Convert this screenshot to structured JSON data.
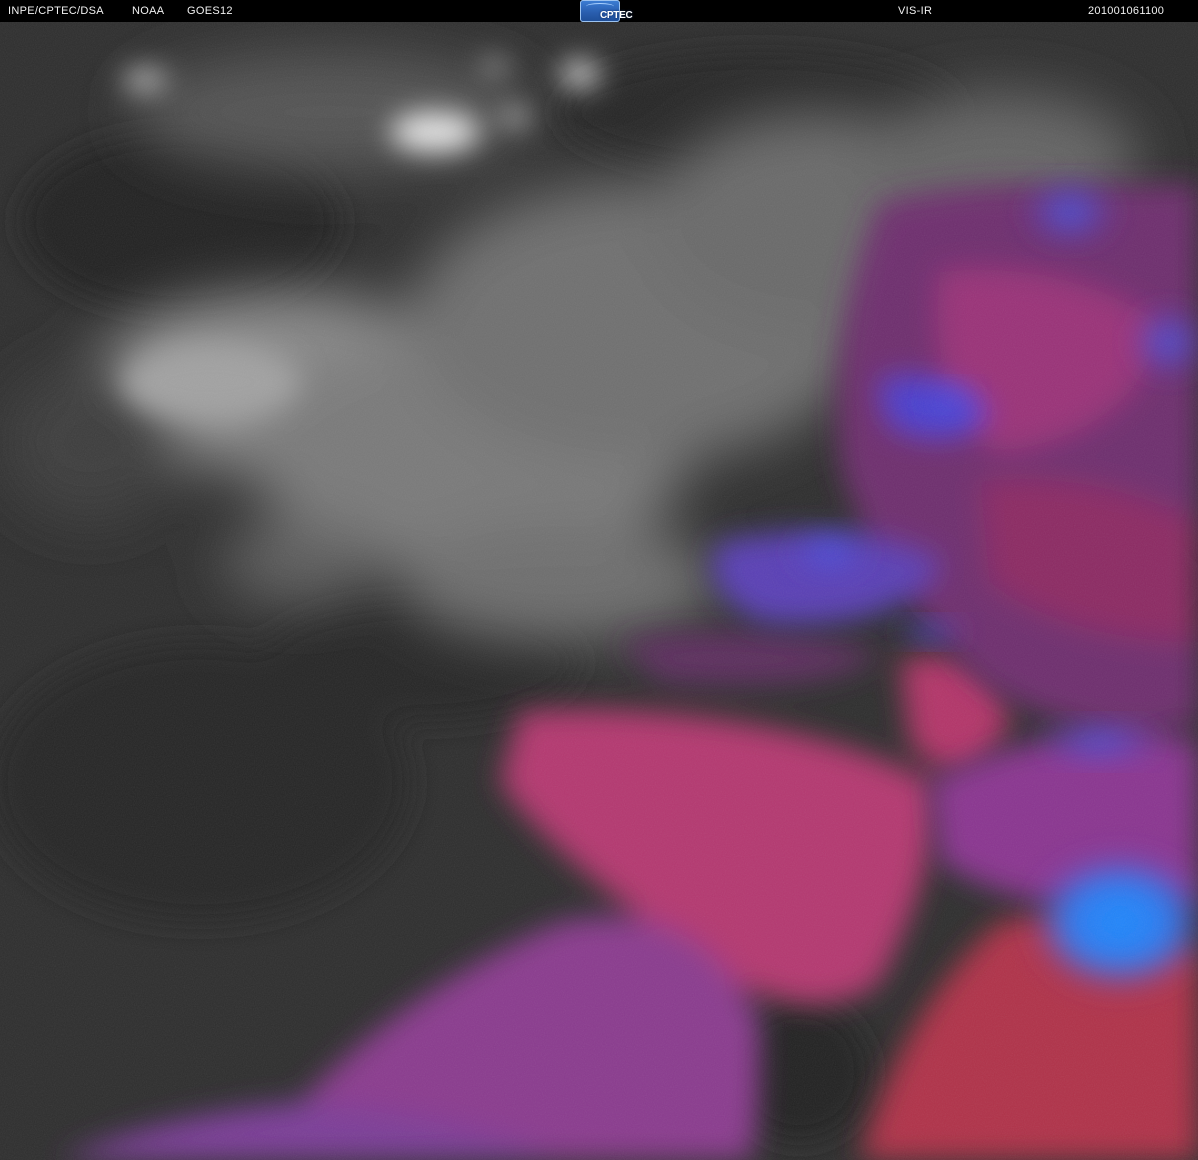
{
  "header": {
    "source": "INPE/CPTEC/DSA",
    "agency": "NOAA",
    "satellite": "GOES12",
    "logo_text": "CPTEC",
    "channel": "VIS-IR",
    "timestamp": "201001061100"
  },
  "colors": {
    "background": "#2c2c2c",
    "header_bar": "#000000",
    "visible_cloud": "#9a9a9a",
    "bright_cloud": "#e6e6e6",
    "ir_warm_magenta": "#b8316f",
    "ir_violet": "#7a3aa8",
    "ir_cold_blue": "#1e8cff"
  }
}
